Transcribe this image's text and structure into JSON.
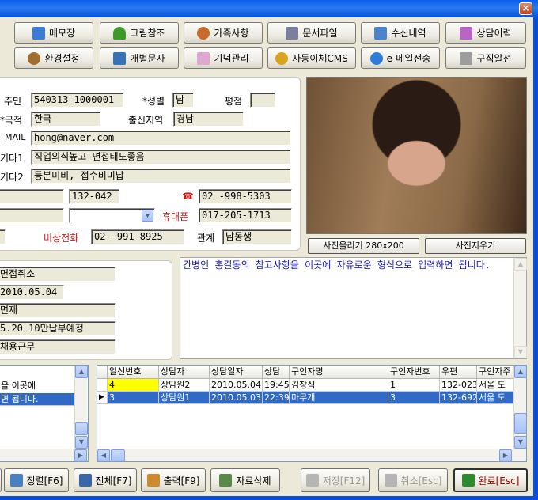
{
  "window": {
    "close_glyph": "×"
  },
  "toolbar": {
    "row1": [
      {
        "label": "메모장",
        "icon": "notepad-icon",
        "color": "#3b7bd4"
      },
      {
        "label": "그림참조",
        "icon": "tree-icon",
        "color": "#3d9a2a"
      },
      {
        "label": "가족사항",
        "icon": "family-icon",
        "color": "#c86a2a"
      },
      {
        "label": "문서파일",
        "icon": "document-icon",
        "color": "#7d7d9e"
      },
      {
        "label": "수신내역",
        "icon": "inbox-icon",
        "color": "#4b84c9"
      },
      {
        "label": "상담이력",
        "icon": "history-icon",
        "color": "#b865c4"
      }
    ],
    "row2": [
      {
        "label": "환경설정",
        "icon": "settings-icon",
        "color": "#a26d2d"
      },
      {
        "label": "개별문자",
        "icon": "sms-icon",
        "color": "#3672b8"
      },
      {
        "label": "기념관리",
        "icon": "cake-icon",
        "color": "#e0a7d3"
      },
      {
        "label": "자동이체CMS",
        "icon": "transfer-icon",
        "color": "#d9a21f"
      },
      {
        "label": "e-메일전송",
        "icon": "email-icon",
        "color": "#2f7bd6"
      },
      {
        "label": "구직알선",
        "icon": "job-icon",
        "color": "#9d9d9d"
      }
    ]
  },
  "form": {
    "resident_label": "주민",
    "resident_value": "540313-1000001",
    "gender_label": "*성별",
    "gender_value": "남",
    "rating_label": "평점",
    "rating_value": "",
    "nationality_label": "*국적",
    "nationality_value": "한국",
    "origin_label": "출신지역",
    "origin_value": "경남",
    "email_label": "MAIL",
    "email_value": "hong@naver.com",
    "etc1_label": "기타1",
    "etc1_value": "직업의식높고 면접태도좋음",
    "etc2_label": "기타2",
    "etc2_value": "등본미비, 접수비미납",
    "zip_value": "132-042",
    "phone_icon": "☎",
    "phone_value": "02  -998-5303",
    "mobile_label": "휴대폰",
    "mobile_value": "017-205-1713",
    "emergency_label": "비상전화",
    "emergency_value": "02  -991-8925",
    "relation_label": "관계",
    "relation_value": "남동생",
    "select_arrow": "▼"
  },
  "photo": {
    "upload_label": "사진올리기 280x200",
    "delete_label": "사진지우기"
  },
  "status": {
    "s1": "면접취소",
    "s2": "2010.05.04",
    "s3": "면제",
    "s4": "5.20 10만납부예정",
    "s5": "채용근무"
  },
  "memo": {
    "text": "간병인 홍길동의 참고사항을 이곳에 자유로운 형식으로 입력하면 됩니다."
  },
  "left_list": {
    "row1": "을 이곳에",
    "row2": "면 됩니다."
  },
  "grid": {
    "headers": [
      "알선번호",
      "상담자",
      "상담일자",
      "상담",
      "구인자명",
      "구인자번호",
      "우편",
      "구인자주"
    ],
    "rows": [
      {
        "marker": "",
        "cells": [
          "4",
          "상담원2",
          "2010.05.04",
          "19:45",
          "김창식",
          "1",
          "132-023",
          "서울 도"
        ]
      },
      {
        "marker": "▶",
        "cells": [
          "3",
          "상담원1",
          "2010.05.03",
          "22:39",
          "마무개",
          "3",
          "132-692",
          "서울 도"
        ]
      }
    ],
    "highlight_color": "#ffff00",
    "selected_color": "#316ac5"
  },
  "scroll": {
    "up": "▲",
    "down": "▼",
    "left": "◀",
    "right": "▶"
  },
  "bottom": [
    {
      "label": "정렬[F6]",
      "icon": "sort-icon",
      "state": "normal"
    },
    {
      "label": "전체[F7]",
      "icon": "all-icon",
      "state": "normal"
    },
    {
      "label": "출력[F9]",
      "icon": "print-icon",
      "state": "normal"
    },
    {
      "label": "자료삭제",
      "icon": "delete-data-icon",
      "state": "normal"
    },
    {
      "label": "저장[F12]",
      "icon": "save-icon",
      "state": "disabled"
    },
    {
      "label": "취소[Esc]",
      "icon": "cancel-icon",
      "state": "disabled"
    },
    {
      "label": "완료[Esc]",
      "icon": "done-icon",
      "state": "default"
    }
  ]
}
